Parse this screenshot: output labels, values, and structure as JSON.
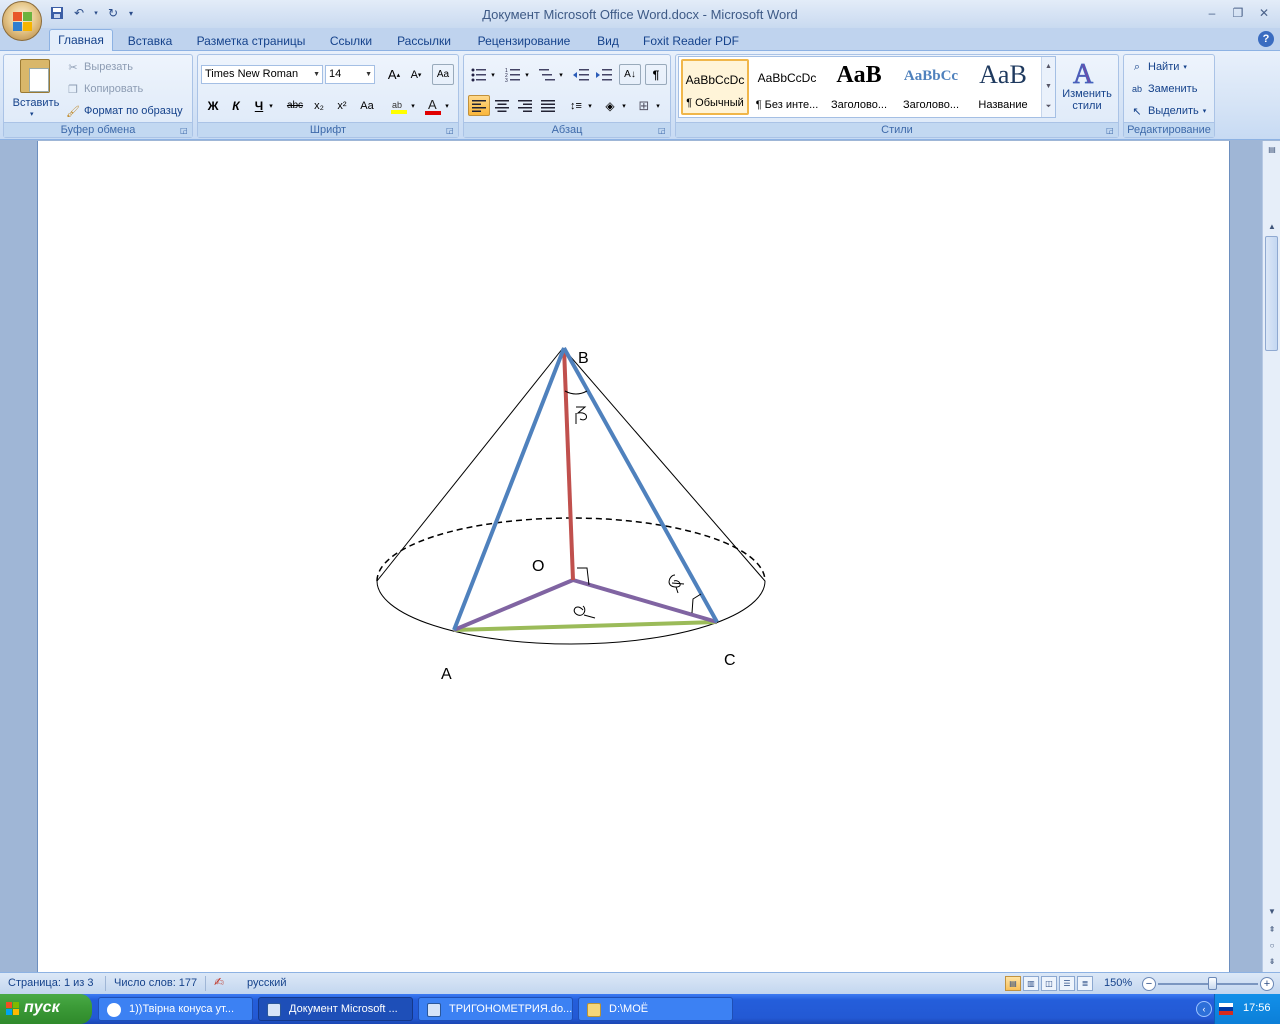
{
  "window": {
    "title": "Документ Microsoft Office Word.docx - Microsoft Word"
  },
  "tabs": [
    "Главная",
    "Вставка",
    "Разметка страницы",
    "Ссылки",
    "Рассылки",
    "Рецензирование",
    "Вид",
    "Foxit Reader PDF"
  ],
  "ribbon": {
    "clipboard": {
      "label": "Буфер обмена",
      "paste": "Вставить",
      "cut": "Вырезать",
      "copy": "Копировать",
      "format_painter": "Формат по образцу"
    },
    "font": {
      "label": "Шрифт",
      "family": "Times New Roman",
      "size": "14",
      "bold": "Ж",
      "italic": "К",
      "underline": "Ч",
      "strike": "abc",
      "subscript": "x₂",
      "superscript": "x²",
      "case": "Aa"
    },
    "paragraph": {
      "label": "Абзац"
    },
    "styles": {
      "label": "Стили",
      "items": [
        {
          "sample": "AaBbCcDc",
          "name": "¶ Обычный"
        },
        {
          "sample": "AaBbCcDc",
          "name": "¶ Без инте..."
        },
        {
          "sample": "AaB",
          "name": "Заголово..."
        },
        {
          "sample": "AaBbCc",
          "name": "Заголово..."
        },
        {
          "sample": "AaB",
          "name": "Название"
        }
      ],
      "change": "Изменить стили"
    },
    "editing": {
      "label": "Редактирование",
      "find": "Найти",
      "replace": "Заменить",
      "select": "Выделить"
    }
  },
  "figure": {
    "labels": {
      "B": "B",
      "O": "O",
      "A": "A",
      "C": "C"
    }
  },
  "statusbar": {
    "page": "Страница: 1 из 3",
    "words": "Число слов: 177",
    "language": "русский",
    "zoom": "150%"
  },
  "taskbar": {
    "start": "пуск",
    "tasks": [
      "1))Твірна конуса ут...",
      "Документ Microsoft ...",
      "ТРИГОНОМЕТРИЯ.do...",
      "D:\\МОЁ"
    ],
    "time": "17:56"
  },
  "colors": {
    "edge_blue": "#4f81bd",
    "height_red": "#c0504d",
    "radius_purple": "#8064a2",
    "chord_green": "#9bbb59"
  }
}
